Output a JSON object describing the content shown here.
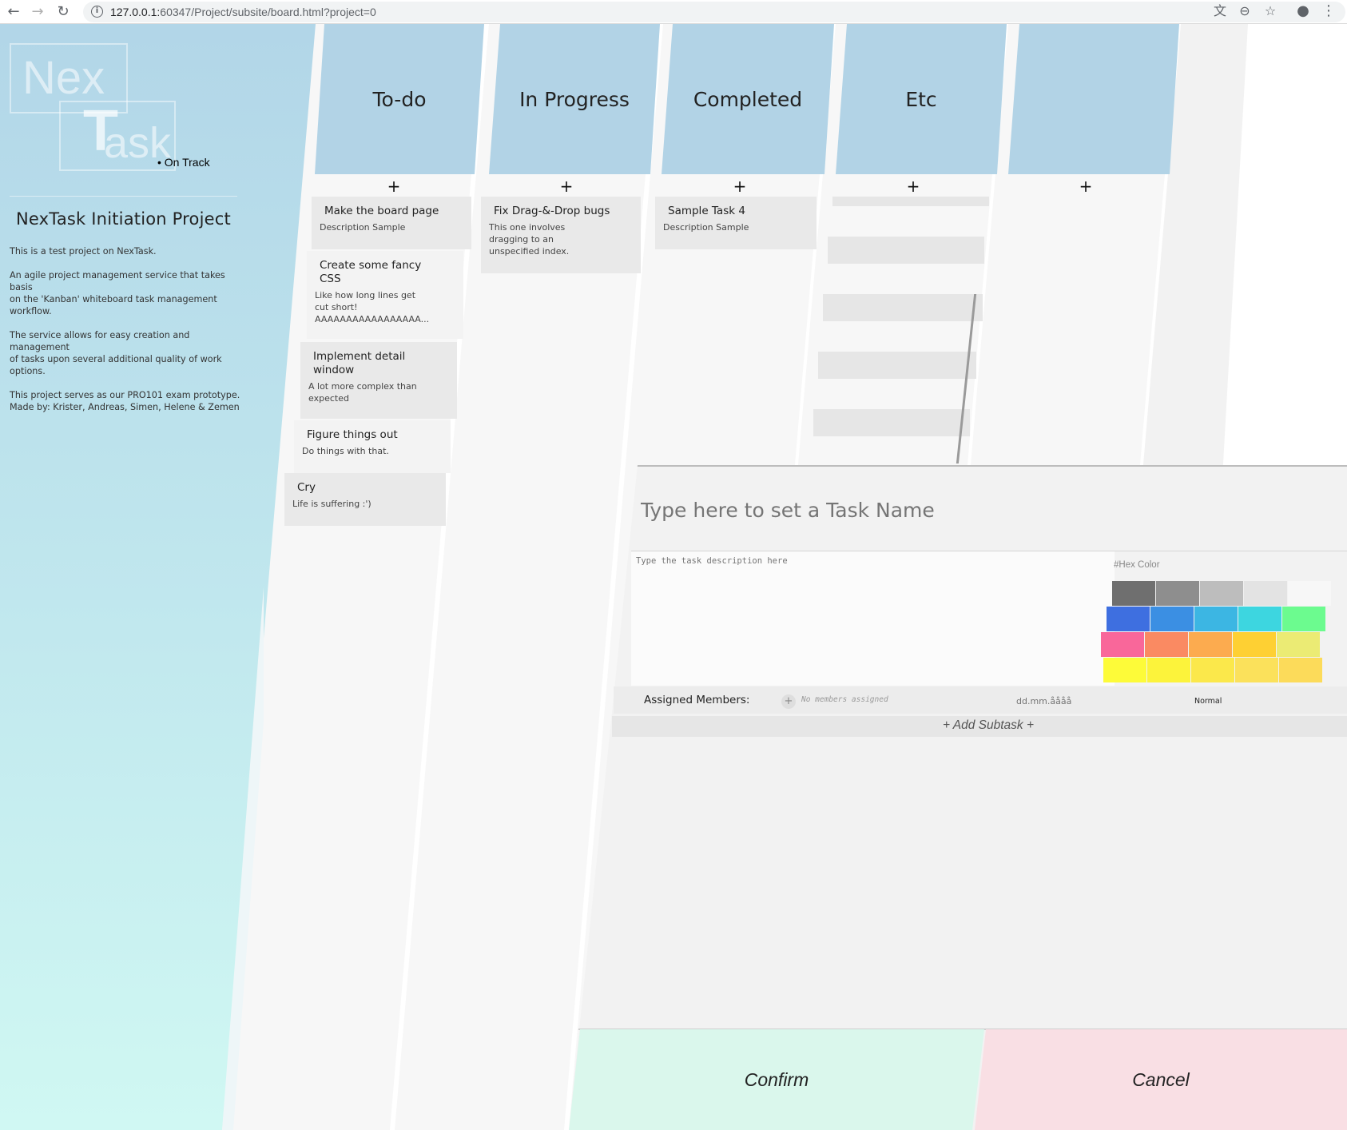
{
  "browser": {
    "back_icon": "←",
    "forward_icon": "→",
    "reload_icon": "↻",
    "info_icon": "i",
    "url_host": "127.0.0.1:",
    "url_rest": "60347/Project/subsite/board.html?project=0",
    "translate_icon": "文",
    "zoom_icon": "⊖",
    "star_icon": "☆",
    "account_icon": "●",
    "menu_icon": "⋮"
  },
  "sidebar": {
    "logo_nex": "Nex",
    "logo_t": "T",
    "logo_ask": "ask",
    "status": "• On Track",
    "project_title": "NexTask Initiation Project",
    "description": [
      "This is a test project on NexTask.",
      "An agile project management service that takes basis\non the 'Kanban' whiteboard task management\nworkflow.",
      "The service allows for easy creation and management\nof tasks upon several additional quality of work options.",
      "This project serves as our PRO101 exam prototype.\nMade by: Krister, Andreas, Simen, Helene & Zemen"
    ]
  },
  "board": {
    "add_label": "+",
    "columns": [
      {
        "title": "To-do",
        "cards": [
          {
            "title": "Make the board page",
            "desc": "Description Sample"
          },
          {
            "title": "Create some fancy\nCSS",
            "desc": "Like how long lines get\ncut short!\nAAAAAAAAAAAAAAAAA..."
          },
          {
            "title": "Implement detail\nwindow",
            "desc": "A lot more complex than\nexpected"
          },
          {
            "title": "Figure things out",
            "desc": "Do things with that."
          },
          {
            "title": "Cry",
            "desc": "Life is suffering :')"
          }
        ]
      },
      {
        "title": "In Progress",
        "cards": [
          {
            "title": "Fix Drag-&-Drop bugs",
            "desc": "This one involves\ndragging to an\nunspecified index."
          }
        ]
      },
      {
        "title": "Completed",
        "cards": [
          {
            "title": "Sample Task 4",
            "desc": "Description Sample"
          }
        ]
      },
      {
        "title": "Etc",
        "cards": []
      },
      {
        "title": "",
        "cards": []
      }
    ]
  },
  "modal": {
    "task_name_placeholder": "Type here to set a Task Name",
    "task_desc_placeholder": "Type the task description here",
    "hex_color_label": "#Hex Color",
    "swatches": [
      "#6f6f6f",
      "#8e8e8e",
      "#bdbdbd",
      "#e3e3e3",
      "#f7f7f7",
      "#3e6fe0",
      "#3b8fe3",
      "#3cb6e3",
      "#3dd6e0",
      "#6cfb8f",
      "#f9679a",
      "#fa8a62",
      "#fcab4f",
      "#fed033",
      "#ebeb74",
      "#fdfb39",
      "#fcf33b",
      "#fbe84b",
      "#fbe15b",
      "#fcdb5a"
    ],
    "members_label": "Assigned Members:",
    "add_member_icon": "+",
    "no_members": "No members assigned",
    "date_placeholder": "dd.mm.åååå",
    "priority": "Normal",
    "add_subtask": "+ Add Subtask +",
    "confirm_label": "Confirm",
    "cancel_label": "Cancel"
  }
}
